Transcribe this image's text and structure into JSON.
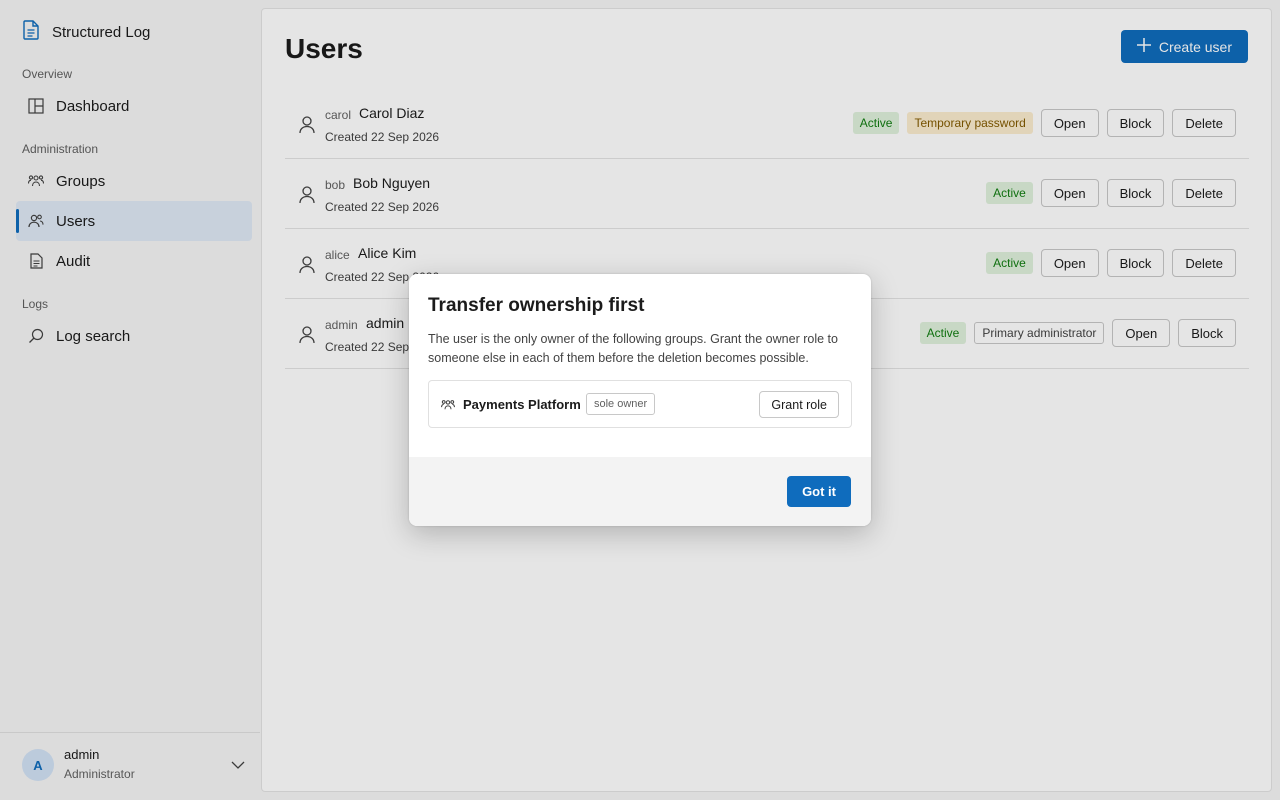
{
  "sidebar": {
    "brand": "Structured Log",
    "sections": {
      "overview": "Overview",
      "administration": "Administration",
      "logs": "Logs"
    },
    "items": {
      "dashboard": "Dashboard",
      "groups": "Groups",
      "users": "Users",
      "audit": "Audit",
      "log_search": "Log search"
    },
    "active_item": "users",
    "footer": {
      "avatar_letter": "A",
      "name": "admin",
      "role": "Administrator"
    }
  },
  "main": {
    "title": "Users",
    "create_button": "Create user",
    "rows": [
      {
        "login": "carol",
        "name": "Carol Diaz",
        "created": "Created 22 Sep 2026",
        "badges": [
          "Active",
          "Temporary password"
        ],
        "actions": [
          "Open",
          "Block",
          "Delete"
        ]
      },
      {
        "login": "bob",
        "name": "Bob Nguyen",
        "created": "Created 22 Sep 2026",
        "badges": [
          "Active"
        ],
        "actions": [
          "Open",
          "Block",
          "Delete"
        ]
      },
      {
        "login": "alice",
        "name": "Alice Kim",
        "created": "Created 22 Sep 2026",
        "badges": [
          "Active"
        ],
        "actions": [
          "Open",
          "Block",
          "Delete"
        ]
      },
      {
        "login": "admin",
        "name": "admin",
        "created": "Created 22 Sep 2026",
        "badges": [
          "Active",
          "Primary administrator"
        ],
        "actions": [
          "Open",
          "Block"
        ]
      }
    ]
  },
  "dialog": {
    "title": "Transfer ownership first",
    "description": "The user is the only owner of the following groups. Grant the owner role to someone else in each of them before the deletion becomes possible.",
    "group": {
      "name": "Payments Platform",
      "tag": "sole owner",
      "action": "Grant role"
    },
    "confirm": "Got it"
  },
  "colors": {
    "accent": "#0f6cbd",
    "active_badge_bg": "#dff1dc",
    "active_badge_text": "#107c10",
    "temp_badge_bg": "#fbecce",
    "temp_badge_text": "#835b00"
  }
}
